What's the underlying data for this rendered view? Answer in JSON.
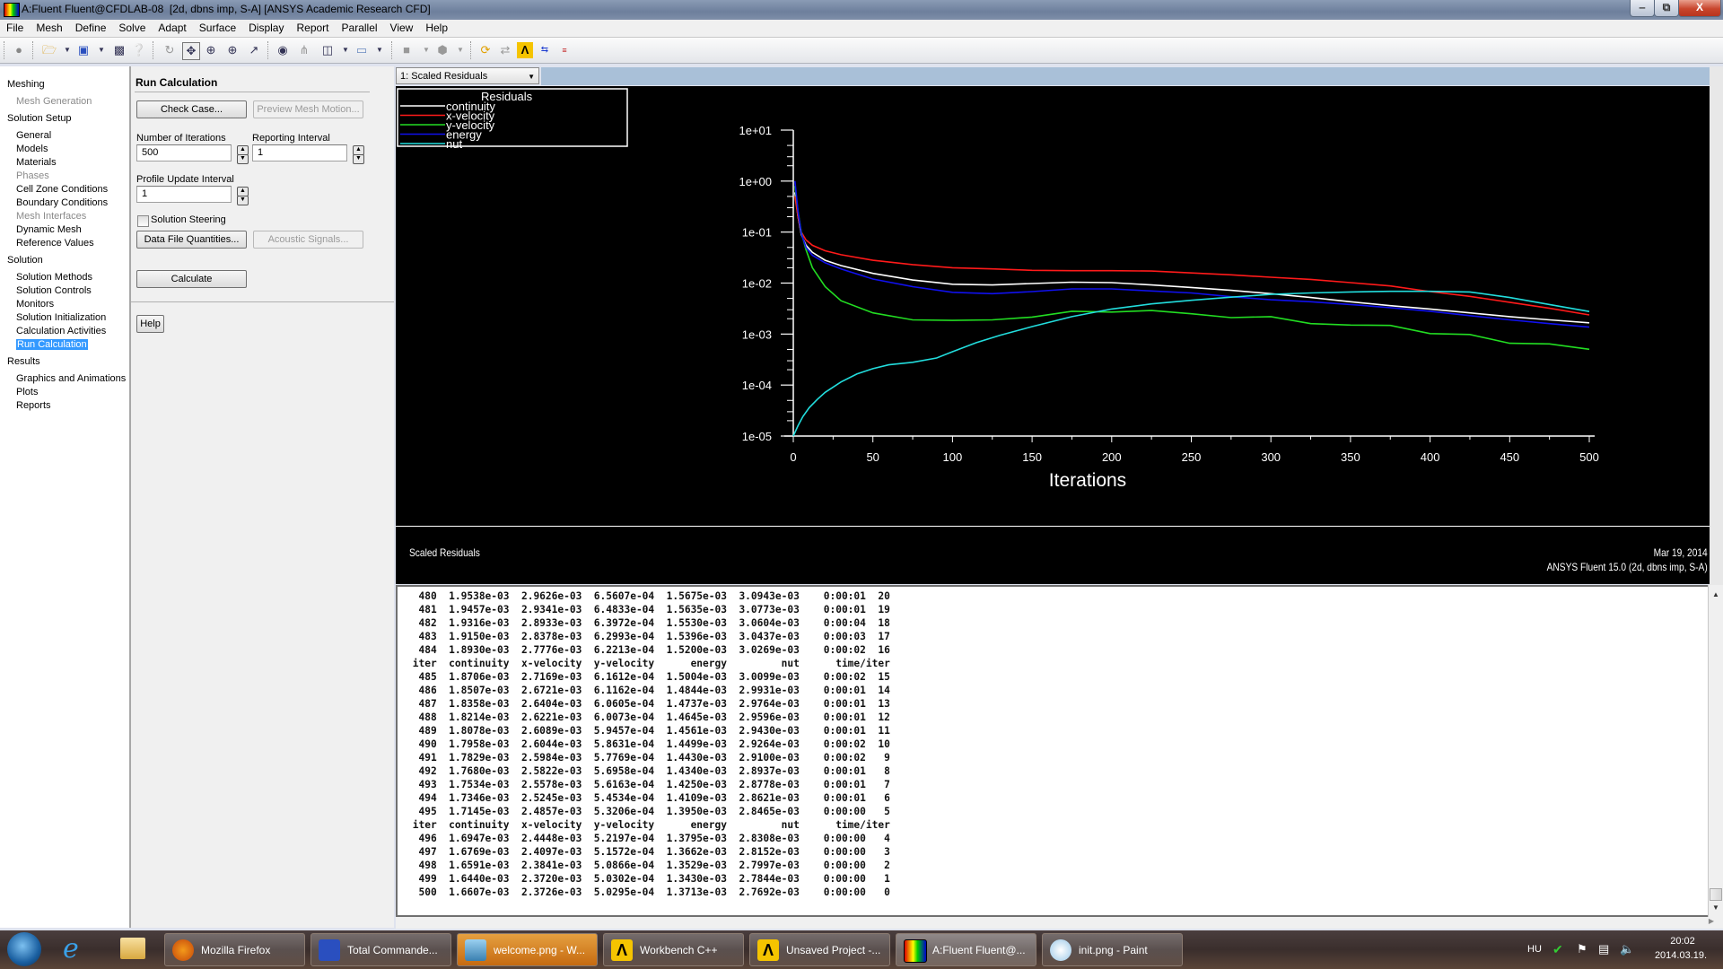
{
  "window": {
    "title": "A:Fluent Fluent@CFDLAB-08  [2d, dbns imp, S-A] [ANSYS Academic Research CFD]",
    "minimize": "‒",
    "restore": "⧉",
    "close": "X"
  },
  "menu": [
    "File",
    "Mesh",
    "Define",
    "Solve",
    "Adapt",
    "Surface",
    "Display",
    "Report",
    "Parallel",
    "View",
    "Help"
  ],
  "toolbar_icons": [
    "stop-icon",
    "open-icon",
    "save-icon",
    "snapshot-icon",
    "help-icon",
    "rotate-icon",
    "pan-icon",
    "zoom-icon",
    "zoom-in-icon",
    "probe-icon",
    "zoom-to-fit-icon",
    "axes-icon",
    "layout-icon",
    "window-icon",
    "shade-icon",
    "views-icon",
    "refresh-icon",
    "sync-icon",
    "ansys-icon",
    "transfer-icon",
    "mode-icon"
  ],
  "nav": {
    "sections": [
      {
        "label": "Meshing",
        "items": [
          {
            "label": "Mesh Generation",
            "enabled": false
          }
        ]
      },
      {
        "label": "Solution Setup",
        "items": [
          {
            "label": "General",
            "enabled": true
          },
          {
            "label": "Models",
            "enabled": true
          },
          {
            "label": "Materials",
            "enabled": true
          },
          {
            "label": "Phases",
            "enabled": false
          },
          {
            "label": "Cell Zone Conditions",
            "enabled": true
          },
          {
            "label": "Boundary Conditions",
            "enabled": true
          },
          {
            "label": "Mesh Interfaces",
            "enabled": false
          },
          {
            "label": "Dynamic Mesh",
            "enabled": true
          },
          {
            "label": "Reference Values",
            "enabled": true
          }
        ]
      },
      {
        "label": "Solution",
        "items": [
          {
            "label": "Solution Methods",
            "enabled": true
          },
          {
            "label": "Solution Controls",
            "enabled": true
          },
          {
            "label": "Monitors",
            "enabled": true
          },
          {
            "label": "Solution Initialization",
            "enabled": true
          },
          {
            "label": "Calculation Activities",
            "enabled": true
          },
          {
            "label": "Run Calculation",
            "enabled": true,
            "selected": true
          }
        ]
      },
      {
        "label": "Results",
        "items": [
          {
            "label": "Graphics and Animations",
            "enabled": true
          },
          {
            "label": "Plots",
            "enabled": true
          },
          {
            "label": "Reports",
            "enabled": true
          }
        ]
      }
    ]
  },
  "task": {
    "title": "Run Calculation",
    "check_case": "Check Case...",
    "preview_mesh_motion": "Preview Mesh Motion...",
    "num_iterations_label": "Number of Iterations",
    "num_iterations_value": "500",
    "reporting_interval_label": "Reporting Interval",
    "reporting_interval_value": "1",
    "profile_update_label": "Profile Update Interval",
    "profile_update_value": "1",
    "solution_steering_label": "Solution Steering",
    "solution_steering_checked": false,
    "data_file_quantities": "Data File Quantities...",
    "acoustic_signals": "Acoustic Signals...",
    "calculate": "Calculate",
    "help": "Help"
  },
  "graphics": {
    "window_select": "1: Scaled Residuals",
    "info_left": "Scaled Residuals",
    "info_date": "Mar 19, 2014",
    "info_version": "ANSYS Fluent 15.0 (2d, dbns imp, S-A)"
  },
  "chart_data": {
    "type": "line",
    "title": "Residuals",
    "xlabel": "Iterations",
    "ylabel": "",
    "yscale": "log",
    "xlim": [
      0,
      500
    ],
    "ylim": [
      1e-05,
      10
    ],
    "xticks": [
      "0",
      "50",
      "100",
      "150",
      "200",
      "250",
      "300",
      "350",
      "400",
      "450",
      "500"
    ],
    "yticks": [
      "1e+01",
      "1e+00",
      "1e-01",
      "1e-02",
      "1e-03",
      "1e-04",
      "1e-05"
    ],
    "legend_position": "top-left",
    "series": [
      {
        "name": "continuity",
        "color": "#ffffff",
        "x": [
          1,
          3,
          5,
          8,
          12,
          20,
          30,
          50,
          75,
          100,
          125,
          150,
          175,
          200,
          225,
          250,
          275,
          300,
          325,
          350,
          375,
          400,
          425,
          450,
          475,
          500
        ],
        "y": [
          0.6,
          0.2,
          0.09,
          0.055,
          0.04,
          0.028,
          0.022,
          0.0155,
          0.0115,
          0.0095,
          0.0092,
          0.0098,
          0.0104,
          0.0102,
          0.0092,
          0.0082,
          0.0072,
          0.0062,
          0.0052,
          0.0043,
          0.0036,
          0.0031,
          0.0026,
          0.0022,
          0.0019,
          0.00166
        ]
      },
      {
        "name": "x-velocity",
        "color": "#ff1a1a",
        "x": [
          1,
          3,
          5,
          8,
          12,
          20,
          30,
          50,
          75,
          100,
          125,
          150,
          175,
          200,
          225,
          250,
          275,
          300,
          325,
          350,
          375,
          400,
          425,
          450,
          475,
          500
        ],
        "y": [
          0.5,
          0.2,
          0.1,
          0.07,
          0.055,
          0.043,
          0.036,
          0.028,
          0.023,
          0.02,
          0.019,
          0.0178,
          0.0175,
          0.0175,
          0.0172,
          0.0158,
          0.0145,
          0.013,
          0.0118,
          0.0102,
          0.0088,
          0.0068,
          0.0055,
          0.0042,
          0.0032,
          0.00237
        ]
      },
      {
        "name": "y-velocity",
        "color": "#22dd22",
        "x": [
          1,
          3,
          5,
          8,
          12,
          20,
          30,
          50,
          75,
          100,
          125,
          150,
          175,
          200,
          225,
          250,
          275,
          300,
          325,
          350,
          375,
          400,
          425,
          450,
          475,
          500
        ],
        "y": [
          0.8,
          0.25,
          0.1,
          0.045,
          0.02,
          0.0085,
          0.0045,
          0.0026,
          0.0019,
          0.00185,
          0.0019,
          0.00215,
          0.0028,
          0.0027,
          0.0029,
          0.0025,
          0.0021,
          0.0022,
          0.0016,
          0.0015,
          0.00148,
          0.00102,
          0.00098,
          0.00066,
          0.00064,
          0.000503
        ]
      },
      {
        "name": "energy",
        "color": "#1010ee",
        "x": [
          1,
          3,
          5,
          8,
          12,
          20,
          30,
          50,
          75,
          100,
          125,
          150,
          175,
          200,
          225,
          250,
          275,
          300,
          325,
          350,
          375,
          400,
          425,
          450,
          475,
          500
        ],
        "y": [
          1.0,
          0.25,
          0.095,
          0.05,
          0.035,
          0.025,
          0.019,
          0.012,
          0.0085,
          0.0066,
          0.0062,
          0.0068,
          0.0077,
          0.0077,
          0.007,
          0.0064,
          0.0054,
          0.0047,
          0.0043,
          0.0038,
          0.0033,
          0.0028,
          0.0023,
          0.0019,
          0.0016,
          0.00137
        ]
      },
      {
        "name": "nut",
        "color": "#22dddd",
        "x": [
          0,
          3,
          6,
          10,
          15,
          20,
          30,
          40,
          50,
          60,
          75,
          90,
          100,
          115,
          130,
          150,
          175,
          200,
          225,
          250,
          275,
          300,
          325,
          350,
          375,
          400,
          425,
          450,
          475,
          500
        ],
        "y": [
          1e-05,
          1.6e-05,
          2.4e-05,
          3.6e-05,
          5.2e-05,
          7.2e-05,
          0.000115,
          0.000165,
          0.00021,
          0.00025,
          0.00028,
          0.00034,
          0.00045,
          0.00068,
          0.00095,
          0.0014,
          0.0022,
          0.0031,
          0.0039,
          0.0046,
          0.0053,
          0.006,
          0.0064,
          0.0067,
          0.0069,
          0.0069,
          0.0067,
          0.0052,
          0.0038,
          0.00277
        ]
      }
    ]
  },
  "console": {
    "header": [
      "iter",
      "continuity",
      "x-velocity",
      "y-velocity",
      "energy",
      "nut",
      "time/iter",
      ""
    ],
    "lines": [
      {
        "type": "row",
        "cells": [
          "480",
          "1.9538e-03",
          "2.9626e-03",
          "6.5607e-04",
          "1.5675e-03",
          "3.0943e-03",
          "0:00:01",
          "20"
        ]
      },
      {
        "type": "row",
        "cells": [
          "481",
          "1.9457e-03",
          "2.9341e-03",
          "6.4833e-04",
          "1.5635e-03",
          "3.0773e-03",
          "0:00:01",
          "19"
        ]
      },
      {
        "type": "row",
        "cells": [
          "482",
          "1.9316e-03",
          "2.8933e-03",
          "6.3972e-04",
          "1.5530e-03",
          "3.0604e-03",
          "0:00:04",
          "18"
        ]
      },
      {
        "type": "row",
        "cells": [
          "483",
          "1.9150e-03",
          "2.8378e-03",
          "6.2993e-04",
          "1.5396e-03",
          "3.0437e-03",
          "0:00:03",
          "17"
        ]
      },
      {
        "type": "row",
        "cells": [
          "484",
          "1.8930e-03",
          "2.7776e-03",
          "6.2213e-04",
          "1.5200e-03",
          "3.0269e-03",
          "0:00:02",
          "16"
        ]
      },
      {
        "type": "header"
      },
      {
        "type": "row",
        "cells": [
          "485",
          "1.8706e-03",
          "2.7169e-03",
          "6.1612e-04",
          "1.5004e-03",
          "3.0099e-03",
          "0:00:02",
          "15"
        ]
      },
      {
        "type": "row",
        "cells": [
          "486",
          "1.8507e-03",
          "2.6721e-03",
          "6.1162e-04",
          "1.4844e-03",
          "2.9931e-03",
          "0:00:01",
          "14"
        ]
      },
      {
        "type": "row",
        "cells": [
          "487",
          "1.8358e-03",
          "2.6404e-03",
          "6.0605e-04",
          "1.4737e-03",
          "2.9764e-03",
          "0:00:01",
          "13"
        ]
      },
      {
        "type": "row",
        "cells": [
          "488",
          "1.8214e-03",
          "2.6221e-03",
          "6.0073e-04",
          "1.4645e-03",
          "2.9596e-03",
          "0:00:01",
          "12"
        ]
      },
      {
        "type": "row",
        "cells": [
          "489",
          "1.8078e-03",
          "2.6089e-03",
          "5.9457e-04",
          "1.4561e-03",
          "2.9430e-03",
          "0:00:01",
          "11"
        ]
      },
      {
        "type": "row",
        "cells": [
          "490",
          "1.7958e-03",
          "2.6044e-03",
          "5.8631e-04",
          "1.4499e-03",
          "2.9264e-03",
          "0:00:02",
          "10"
        ]
      },
      {
        "type": "row",
        "cells": [
          "491",
          "1.7829e-03",
          "2.5984e-03",
          "5.7769e-04",
          "1.4430e-03",
          "2.9100e-03",
          "0:00:02",
          "9"
        ]
      },
      {
        "type": "row",
        "cells": [
          "492",
          "1.7680e-03",
          "2.5822e-03",
          "5.6958e-04",
          "1.4340e-03",
          "2.8937e-03",
          "0:00:01",
          "8"
        ]
      },
      {
        "type": "row",
        "cells": [
          "493",
          "1.7534e-03",
          "2.5578e-03",
          "5.6163e-04",
          "1.4250e-03",
          "2.8778e-03",
          "0:00:01",
          "7"
        ]
      },
      {
        "type": "row",
        "cells": [
          "494",
          "1.7346e-03",
          "2.5245e-03",
          "5.4534e-04",
          "1.4109e-03",
          "2.8621e-03",
          "0:00:01",
          "6"
        ]
      },
      {
        "type": "row",
        "cells": [
          "495",
          "1.7145e-03",
          "2.4857e-03",
          "5.3206e-04",
          "1.3950e-03",
          "2.8465e-03",
          "0:00:00",
          "5"
        ]
      },
      {
        "type": "header"
      },
      {
        "type": "row",
        "cells": [
          "496",
          "1.6947e-03",
          "2.4448e-03",
          "5.2197e-04",
          "1.3795e-03",
          "2.8308e-03",
          "0:00:00",
          "4"
        ]
      },
      {
        "type": "row",
        "cells": [
          "497",
          "1.6769e-03",
          "2.4097e-03",
          "5.1572e-04",
          "1.3662e-03",
          "2.8152e-03",
          "0:00:00",
          "3"
        ]
      },
      {
        "type": "row",
        "cells": [
          "498",
          "1.6591e-03",
          "2.3841e-03",
          "5.0866e-04",
          "1.3529e-03",
          "2.7997e-03",
          "0:00:00",
          "2"
        ]
      },
      {
        "type": "row",
        "cells": [
          "499",
          "1.6440e-03",
          "2.3720e-03",
          "5.0302e-04",
          "1.3430e-03",
          "2.7844e-03",
          "0:00:00",
          "1"
        ]
      },
      {
        "type": "row",
        "cells": [
          "500",
          "1.6607e-03",
          "2.3726e-03",
          "5.0295e-04",
          "1.3713e-03",
          "2.7692e-03",
          "0:00:00",
          "0"
        ]
      }
    ]
  },
  "taskbar": {
    "items": [
      {
        "label": "Mozilla Firefox",
        "icon": "firefox-icon",
        "color": "#e8701a"
      },
      {
        "label": "Total Commande...",
        "icon": "floppy-icon",
        "color": "#2a4fbf"
      },
      {
        "label": "welcome.png - W...",
        "icon": "image-viewer-icon",
        "color": "#4a90c0",
        "active": true
      },
      {
        "label": "Workbench C++",
        "icon": "ansys-icon",
        "color": "#f5c400"
      },
      {
        "label": "Unsaved Project -...",
        "icon": "ansys-icon",
        "color": "#f5c400"
      },
      {
        "label": "A:Fluent Fluent@...",
        "icon": "fluent-icon",
        "color": "#c02020"
      },
      {
        "label": "init.png - Paint",
        "icon": "paint-icon",
        "color": "#6aa0d0"
      }
    ],
    "language": "HU",
    "time": "20:02",
    "date": "2014.03.19."
  }
}
